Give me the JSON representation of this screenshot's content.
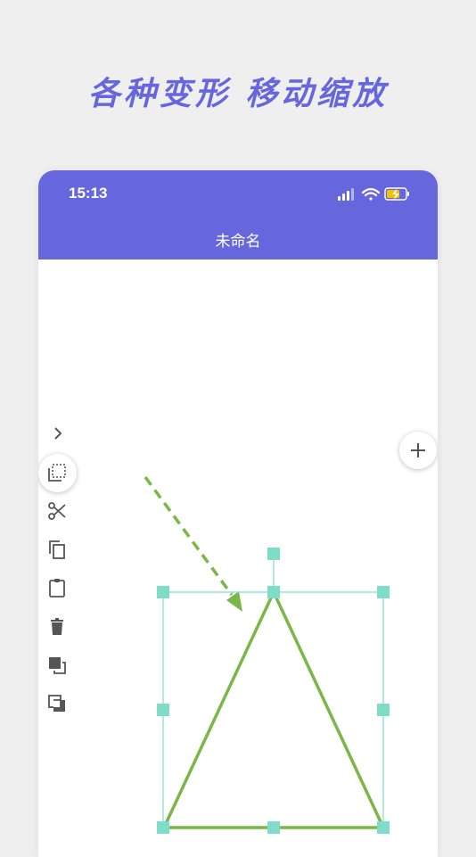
{
  "headline": "各种变形 移动缩放",
  "status": {
    "time": "15:13"
  },
  "app": {
    "title": "未命名"
  },
  "colors": {
    "accent": "#6767dd",
    "shape_stroke": "#7ab648",
    "selection": "#7fdcc6",
    "icon": "#555555"
  },
  "toolbar": {
    "icons": [
      "chevron-right-icon",
      "select-area-icon",
      "scissors-icon",
      "copy-icon",
      "clipboard-icon",
      "trash-icon",
      "bring-front-icon",
      "send-back-icon"
    ]
  },
  "fab": {
    "icon": "plus-icon"
  }
}
